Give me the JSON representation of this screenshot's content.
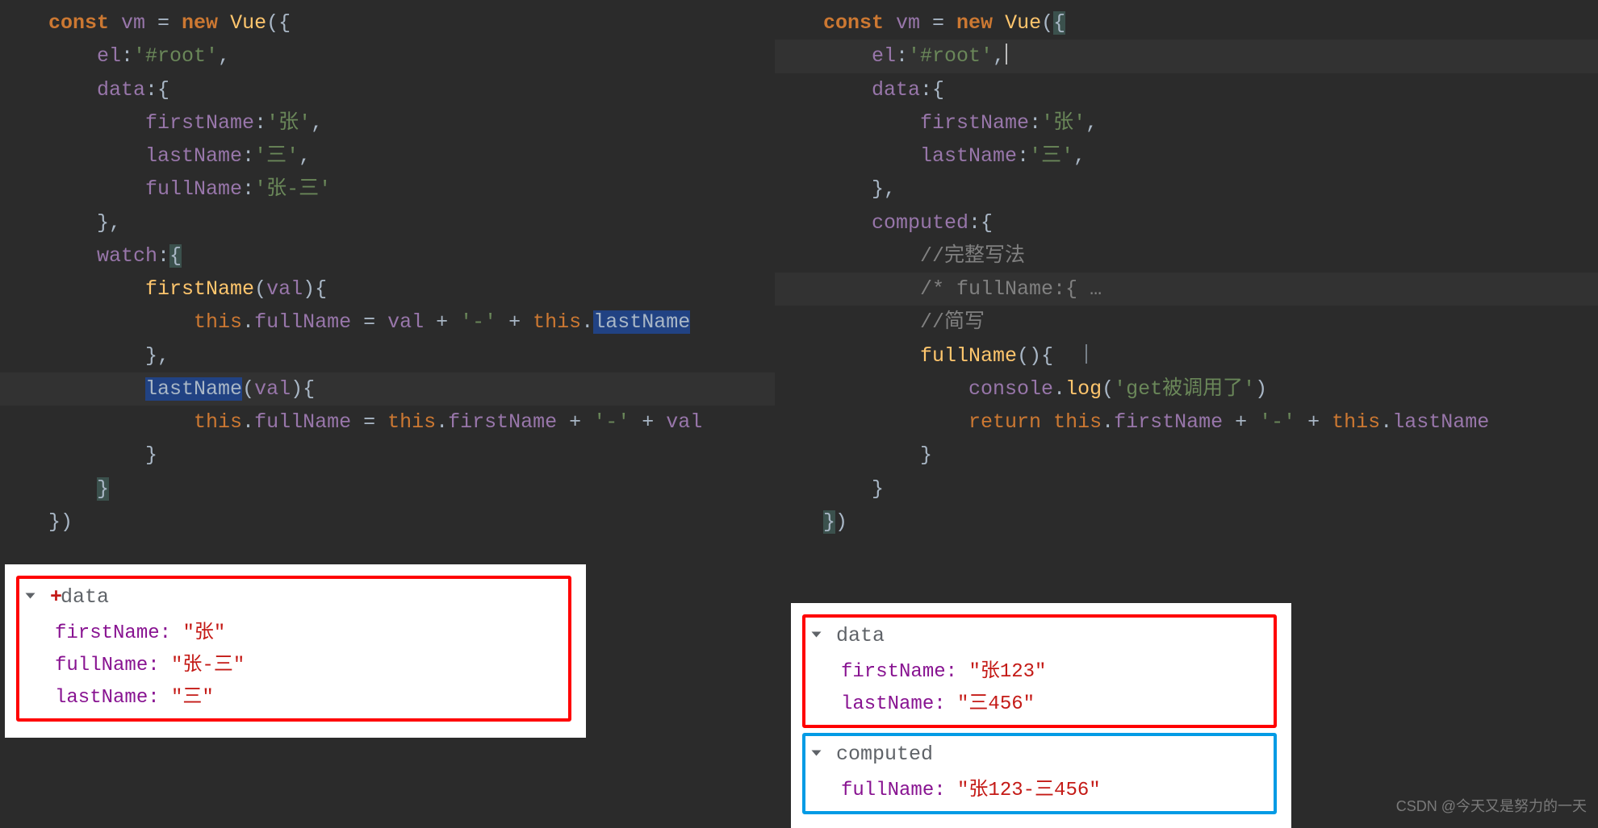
{
  "left_code": [
    [
      [
        "kw",
        "const "
      ],
      [
        "var",
        "vm"
      ],
      [
        "punc",
        " = "
      ],
      [
        "kw",
        "new "
      ],
      [
        "fn",
        "Vue"
      ],
      [
        "punc",
        "({"
      ]
    ],
    [
      [
        "punc",
        "    "
      ],
      [
        "prop",
        "el"
      ],
      [
        "punc",
        ":"
      ],
      [
        "str",
        "'#root'"
      ],
      [
        "punc",
        ","
      ]
    ],
    [
      [
        "punc",
        "    "
      ],
      [
        "prop",
        "data"
      ],
      [
        "punc",
        ":{"
      ]
    ],
    [
      [
        "punc",
        "        "
      ],
      [
        "prop",
        "firstName"
      ],
      [
        "punc",
        ":"
      ],
      [
        "str",
        "'张'"
      ],
      [
        "punc",
        ","
      ]
    ],
    [
      [
        "punc",
        "        "
      ],
      [
        "prop",
        "lastName"
      ],
      [
        "punc",
        ":"
      ],
      [
        "str",
        "'三'"
      ],
      [
        "punc",
        ","
      ]
    ],
    [
      [
        "punc",
        "        "
      ],
      [
        "prop",
        "fullName"
      ],
      [
        "punc",
        ":"
      ],
      [
        "str",
        "'张-三'"
      ]
    ],
    [
      [
        "punc",
        "    },"
      ]
    ],
    [
      [
        "punc",
        "    "
      ],
      [
        "prop",
        "watch"
      ],
      [
        "punc",
        ":"
      ],
      [
        "bracket-hl",
        "{"
      ]
    ],
    [
      [
        "punc",
        "        "
      ],
      [
        "fn",
        "firstName"
      ],
      [
        "punc",
        "("
      ],
      [
        "var",
        "val"
      ],
      [
        "punc",
        "){"
      ]
    ],
    [
      [
        "punc",
        "            "
      ],
      [
        "kw2",
        "this"
      ],
      [
        "punc",
        "."
      ],
      [
        "prop",
        "fullName"
      ],
      [
        "punc",
        " = "
      ],
      [
        "var",
        "val"
      ],
      [
        "punc",
        " + "
      ],
      [
        "str",
        "'-'"
      ],
      [
        "punc",
        " + "
      ],
      [
        "kw2",
        "this"
      ],
      [
        "punc",
        "."
      ],
      [
        "hl",
        "lastName"
      ]
    ],
    [
      [
        "punc",
        "        },"
      ]
    ],
    [
      [
        "punc",
        "        "
      ],
      [
        "hl",
        "lastName"
      ],
      [
        "punc",
        "("
      ],
      [
        "var",
        "val"
      ],
      [
        "punc",
        "){"
      ]
    ],
    [
      [
        "punc",
        "            "
      ],
      [
        "kw2",
        "this"
      ],
      [
        "punc",
        "."
      ],
      [
        "prop",
        "fullName"
      ],
      [
        "punc",
        " = "
      ],
      [
        "kw2",
        "this"
      ],
      [
        "punc",
        "."
      ],
      [
        "prop",
        "firstName"
      ],
      [
        "punc",
        " + "
      ],
      [
        "str",
        "'-'"
      ],
      [
        "punc",
        " + "
      ],
      [
        "var",
        "val"
      ]
    ],
    [
      [
        "punc",
        "        }"
      ]
    ],
    [
      [
        "punc",
        "    "
      ],
      [
        "bracket-hl",
        "}"
      ]
    ],
    [
      [
        "punc",
        "})"
      ]
    ]
  ],
  "right_code": [
    [
      [
        "kw",
        "const "
      ],
      [
        "var",
        "vm"
      ],
      [
        "punc",
        " = "
      ],
      [
        "kw",
        "new "
      ],
      [
        "fn",
        "Vue"
      ],
      [
        "punc",
        "("
      ],
      [
        "bracket-hl",
        "{"
      ]
    ],
    [
      [
        "punc",
        "    "
      ],
      [
        "prop",
        "el"
      ],
      [
        "punc",
        ":"
      ],
      [
        "str",
        "'#root'"
      ],
      [
        "punc",
        ","
      ],
      [
        "caret",
        ""
      ]
    ],
    [
      [
        "punc",
        "    "
      ],
      [
        "prop",
        "data"
      ],
      [
        "punc",
        ":{"
      ]
    ],
    [
      [
        "punc",
        "        "
      ],
      [
        "prop",
        "firstName"
      ],
      [
        "punc",
        ":"
      ],
      [
        "str",
        "'张'"
      ],
      [
        "punc",
        ","
      ]
    ],
    [
      [
        "punc",
        "        "
      ],
      [
        "prop",
        "lastName"
      ],
      [
        "punc",
        ":"
      ],
      [
        "str",
        "'三'"
      ],
      [
        "punc",
        ","
      ]
    ],
    [
      [
        "punc",
        "    },"
      ]
    ],
    [
      [
        "punc",
        "    "
      ],
      [
        "prop",
        "computed"
      ],
      [
        "punc",
        ":{"
      ]
    ],
    [
      [
        "punc",
        "        "
      ],
      [
        "cmt",
        "//完整写法"
      ]
    ],
    [
      [
        "punc",
        "        "
      ],
      [
        "cmt",
        "/* fullName:{ …"
      ]
    ],
    [
      [
        "punc",
        "        "
      ],
      [
        "cmt",
        "//简写"
      ]
    ],
    [
      [
        "punc",
        "        "
      ],
      [
        "fn",
        "fullName"
      ],
      [
        "punc",
        "(){"
      ],
      [
        "ibeam",
        ""
      ]
    ],
    [
      [
        "punc",
        "            "
      ],
      [
        "prop",
        "console"
      ],
      [
        "punc",
        "."
      ],
      [
        "fn",
        "log"
      ],
      [
        "punc",
        "("
      ],
      [
        "str",
        "'get被调用了'"
      ],
      [
        "punc",
        ")"
      ]
    ],
    [
      [
        "punc",
        "            "
      ],
      [
        "kw2",
        "return "
      ],
      [
        "kw2",
        "this"
      ],
      [
        "punc",
        "."
      ],
      [
        "prop",
        "firstName"
      ],
      [
        "punc",
        " + "
      ],
      [
        "str",
        "'-'"
      ],
      [
        "punc",
        " + "
      ],
      [
        "kw2",
        "this"
      ],
      [
        "punc",
        "."
      ],
      [
        "prop",
        "lastName"
      ]
    ],
    [
      [
        "punc",
        "        }"
      ]
    ],
    [
      [
        "punc",
        "    }"
      ]
    ],
    [
      [
        "bracket-hl",
        "}"
      ],
      [
        "punc",
        ")"
      ]
    ]
  ],
  "left_highlight_rows": [
    11
  ],
  "right_highlight_rows": [
    1,
    8
  ],
  "dev_left": {
    "section": "data",
    "rows": [
      {
        "k": "firstName",
        "v": "\"张\""
      },
      {
        "k": "fullName",
        "v": "\"张-三\""
      },
      {
        "k": "lastName",
        "v": "\"三\""
      }
    ]
  },
  "dev_right": {
    "data_section": "data",
    "data_rows": [
      {
        "k": "firstName",
        "v": "\"张123\""
      },
      {
        "k": "lastName",
        "v": "\"三456\""
      }
    ],
    "computed_section": "computed",
    "computed_rows": [
      {
        "k": "fullName",
        "v": "\"张123-三456\""
      }
    ]
  },
  "watermark": "CSDN @今天又是努力的一天"
}
